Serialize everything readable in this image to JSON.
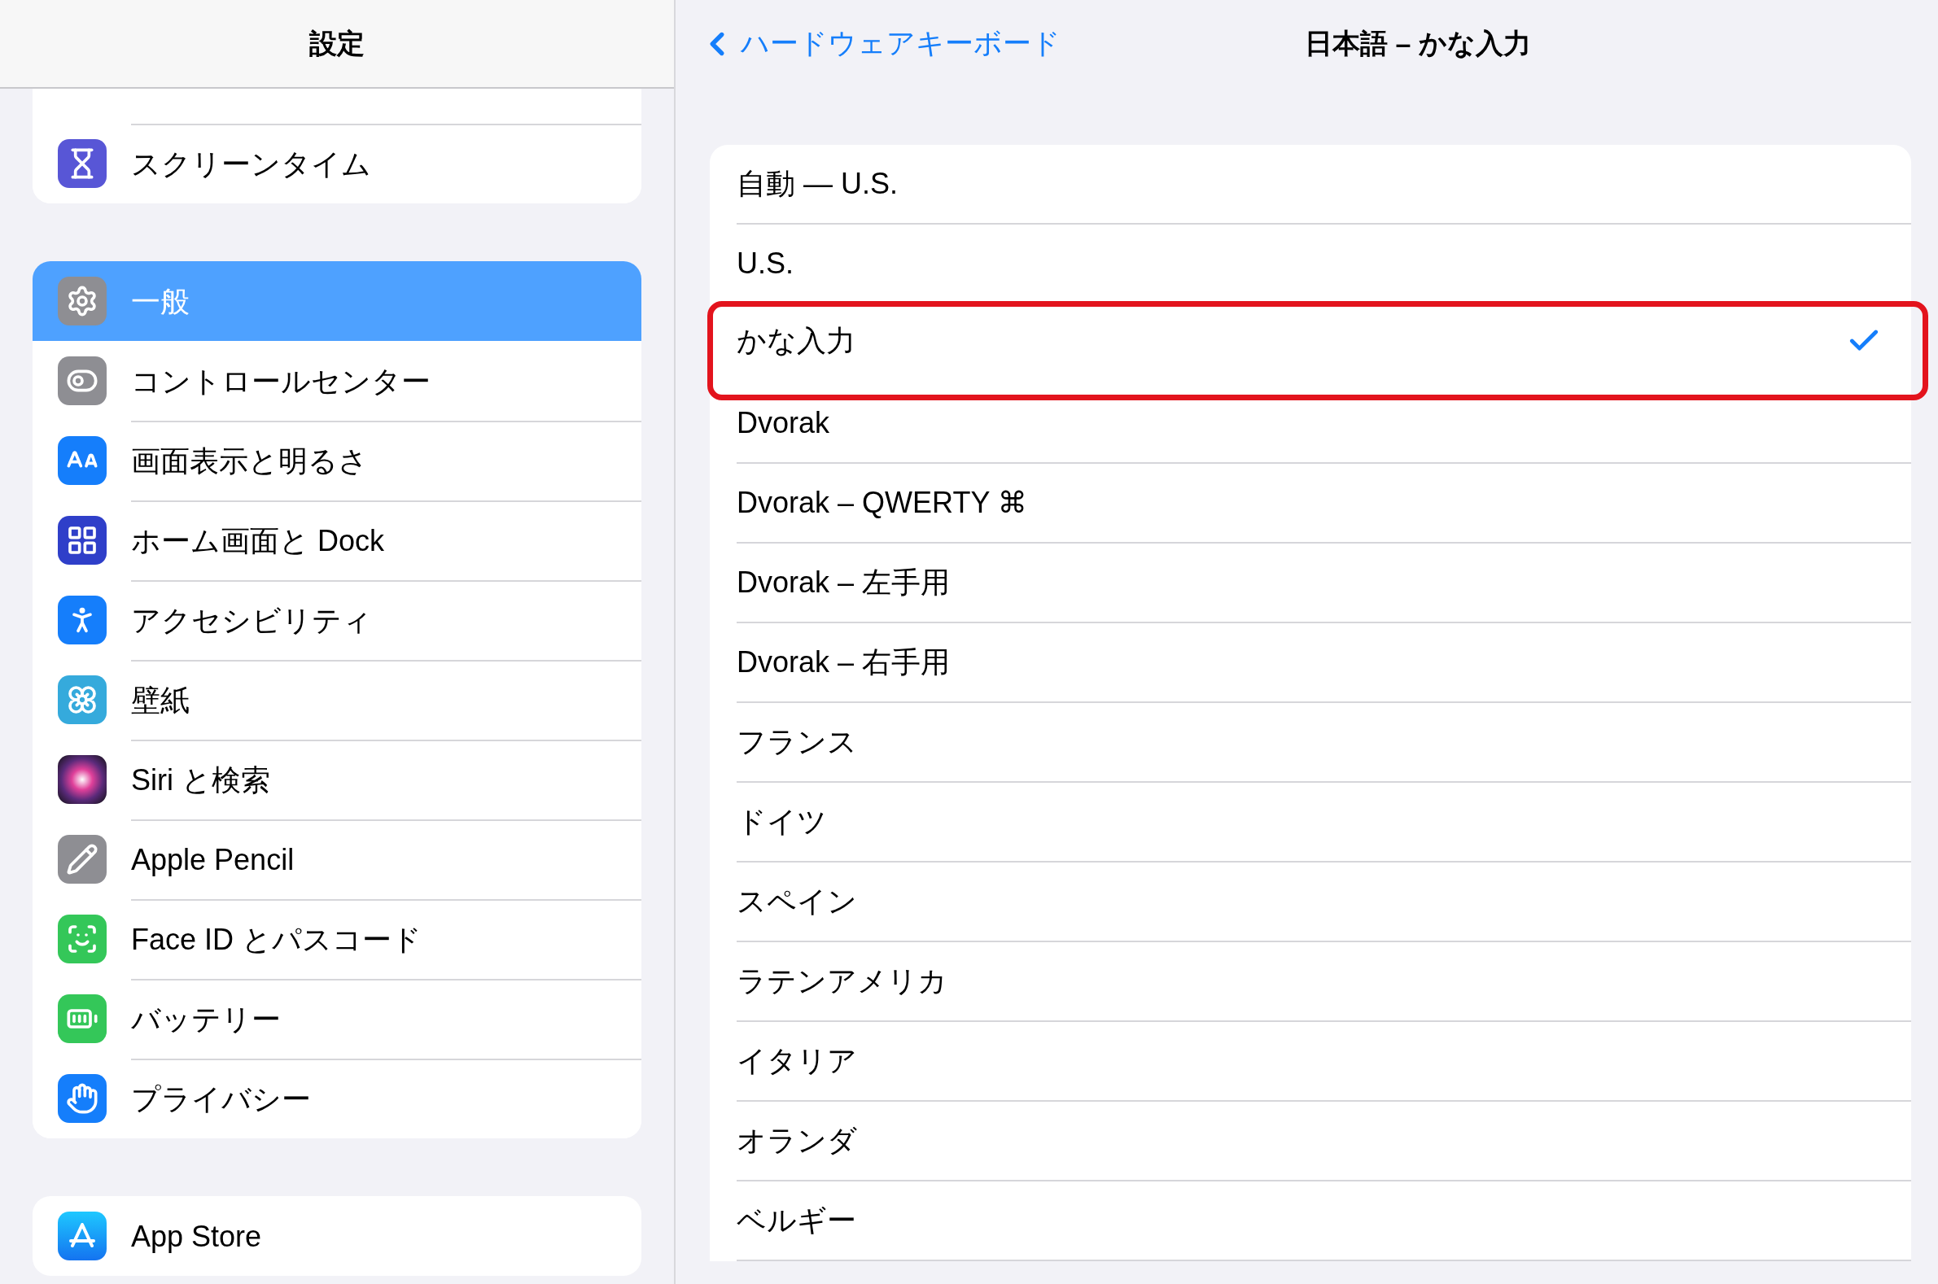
{
  "sidebar": {
    "title": "設定",
    "groups": [
      {
        "cut_top": true,
        "items": [
          {
            "label": "スクリーンタイム",
            "kind": "screentime",
            "selected": false
          }
        ]
      },
      {
        "items": [
          {
            "label": "一般",
            "kind": "general",
            "selected": true
          },
          {
            "label": "コントロールセンター",
            "kind": "control",
            "selected": false
          },
          {
            "label": "画面表示と明るさ",
            "kind": "display",
            "selected": false
          },
          {
            "label": "ホーム画面と Dock",
            "kind": "home",
            "selected": false
          },
          {
            "label": "アクセシビリティ",
            "kind": "accessibility",
            "selected": false
          },
          {
            "label": "壁紙",
            "kind": "wallpaper",
            "selected": false
          },
          {
            "label": "Siri と検索",
            "kind": "siri",
            "selected": false
          },
          {
            "label": "Apple Pencil",
            "kind": "pencil",
            "selected": false
          },
          {
            "label": "Face ID とパスコード",
            "kind": "faceid",
            "selected": false
          },
          {
            "label": "バッテリー",
            "kind": "battery",
            "selected": false
          },
          {
            "label": "プライバシー",
            "kind": "privacy",
            "selected": false
          }
        ]
      },
      {
        "items": [
          {
            "label": "App Store",
            "kind": "appstore",
            "selected": false
          }
        ]
      }
    ]
  },
  "detail": {
    "back": "ハードウェアキーボード",
    "title": "日本語 – かな入力",
    "layouts": [
      {
        "label": "自動 — U.S.",
        "checked": false,
        "highlighted": false
      },
      {
        "label": "U.S.",
        "checked": false,
        "highlighted": false
      },
      {
        "label": "かな入力",
        "checked": true,
        "highlighted": true
      },
      {
        "label": "Dvorak",
        "checked": false,
        "highlighted": false
      },
      {
        "label": "Dvorak – QWERTY ⌘",
        "checked": false,
        "highlighted": false
      },
      {
        "label": "Dvorak – 左手用",
        "checked": false,
        "highlighted": false
      },
      {
        "label": "Dvorak – 右手用",
        "checked": false,
        "highlighted": false
      },
      {
        "label": "フランス",
        "checked": false,
        "highlighted": false
      },
      {
        "label": "ドイツ",
        "checked": false,
        "highlighted": false
      },
      {
        "label": "スペイン",
        "checked": false,
        "highlighted": false
      },
      {
        "label": "ラテンアメリカ",
        "checked": false,
        "highlighted": false
      },
      {
        "label": "イタリア",
        "checked": false,
        "highlighted": false
      },
      {
        "label": "オランダ",
        "checked": false,
        "highlighted": false
      },
      {
        "label": "ベルギー",
        "checked": false,
        "highlighted": false
      }
    ]
  }
}
